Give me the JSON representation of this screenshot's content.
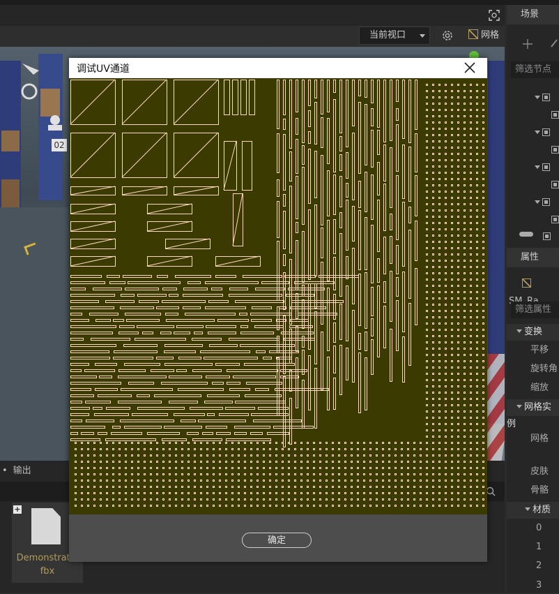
{
  "toolbar": {
    "view_select": "当前视口",
    "grid_toggle": "网格"
  },
  "right_panel": {
    "scene_tab": "场景",
    "filter_nodes_placeholder": "筛选节点",
    "properties_tab": "属性",
    "selected_object": "SM_Ra",
    "filter_props_placeholder": "筛选属性",
    "transform_section": "变换",
    "translate": "平移",
    "rotate": "旋转角",
    "scale": "缩放",
    "mesh_instance_section": "网格实例",
    "mesh": "网格",
    "skin": "皮肤",
    "skeleton": "骨骼",
    "material_section": "材质",
    "material_slots": [
      "0",
      "1",
      "2",
      "3"
    ]
  },
  "bottom_panel": {
    "output_tab": "输出",
    "asset_name_line1": "Demonstratio",
    "asset_name_line2": "fbx"
  },
  "viewport": {
    "label": "02"
  },
  "dialog": {
    "title": "调试UV通道",
    "confirm_button": "确定"
  },
  "colors": {
    "uv_background": "#3b3a00",
    "uv_lines": "#ffd9c4",
    "accent": "#b49b5a"
  }
}
